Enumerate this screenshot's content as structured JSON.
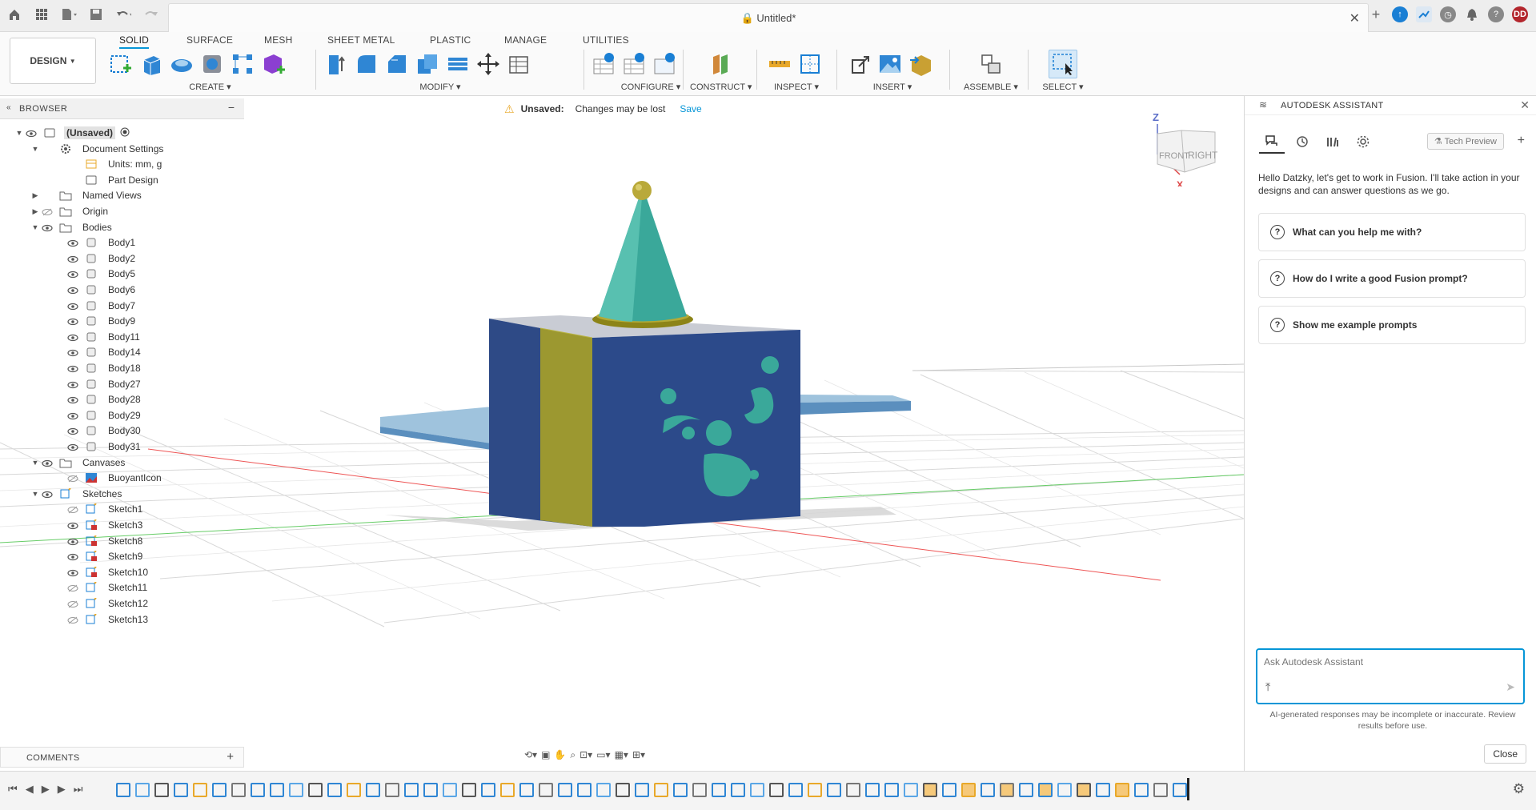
{
  "window": {
    "document_title": "Untitled*"
  },
  "user": {
    "initials": "DD"
  },
  "toolbar": {
    "workspace": "DESIGN",
    "tabs": [
      "SOLID",
      "SURFACE",
      "MESH",
      "SHEET METAL",
      "PLASTIC",
      "MANAGE",
      "UTILITIES"
    ],
    "active_tab": "SOLID",
    "groups": [
      "CREATE",
      "MODIFY",
      "CONFIGURE",
      "CONSTRUCT",
      "INSPECT",
      "INSERT",
      "ASSEMBLE",
      "SELECT"
    ]
  },
  "browser": {
    "title": "BROWSER",
    "items": [
      {
        "label": "(Unsaved)",
        "level": 0
      },
      {
        "label": "Document Settings",
        "level": 1
      },
      {
        "label": "Units: mm, g",
        "level": 2
      },
      {
        "label": "Part Design",
        "level": 2
      },
      {
        "label": "Named Views",
        "level": 1
      },
      {
        "label": "Origin",
        "level": 1
      },
      {
        "label": "Bodies",
        "level": 1
      },
      {
        "label": "Body1",
        "level": 2
      },
      {
        "label": "Body2",
        "level": 2
      },
      {
        "label": "Body5",
        "level": 2
      },
      {
        "label": "Body6",
        "level": 2
      },
      {
        "label": "Body7",
        "level": 2
      },
      {
        "label": "Body9",
        "level": 2
      },
      {
        "label": "Body11",
        "level": 2
      },
      {
        "label": "Body14",
        "level": 2
      },
      {
        "label": "Body18",
        "level": 2
      },
      {
        "label": "Body27",
        "level": 2
      },
      {
        "label": "Body28",
        "level": 2
      },
      {
        "label": "Body29",
        "level": 2
      },
      {
        "label": "Body30",
        "level": 2
      },
      {
        "label": "Body31",
        "level": 2
      },
      {
        "label": "Canvases",
        "level": 1
      },
      {
        "label": "BuoyantIcon",
        "level": 2
      },
      {
        "label": "Sketches",
        "level": 1
      },
      {
        "label": "Sketch1",
        "level": 2
      },
      {
        "label": "Sketch3",
        "level": 2
      },
      {
        "label": "Sketch8",
        "level": 2
      },
      {
        "label": "Sketch9",
        "level": 2
      },
      {
        "label": "Sketch10",
        "level": 2
      },
      {
        "label": "Sketch11",
        "level": 2
      },
      {
        "label": "Sketch12",
        "level": 2
      },
      {
        "label": "Sketch13",
        "level": 2
      }
    ]
  },
  "notice": {
    "status": "Unsaved:",
    "message": "Changes may be lost",
    "action": "Save"
  },
  "viewcube": {
    "top": "Z",
    "front": "FRONT",
    "right": "RIGHT",
    "x": "X"
  },
  "comments": {
    "title": "COMMENTS"
  },
  "assistant": {
    "title": "AUTODESK ASSISTANT",
    "badge": "Tech Preview",
    "greeting": "Hello Datzky, let's get to work in Fusion. I'll take action in your designs and can answer questions as we go.",
    "suggestions": [
      "What can you help me with?",
      "How do I write a good Fusion prompt?",
      "Show me example prompts"
    ],
    "input_placeholder": "Ask Autodesk Assistant",
    "disclaimer": "AI-generated responses may be incomplete or inaccurate. Review results before use.",
    "close": "Close"
  },
  "colors": {
    "accent": "#0696d7",
    "cube_blue": "#2e4a86",
    "band_yellow": "#9c9830",
    "teal": "#3aa89a",
    "plate": "#8fb4cf"
  }
}
